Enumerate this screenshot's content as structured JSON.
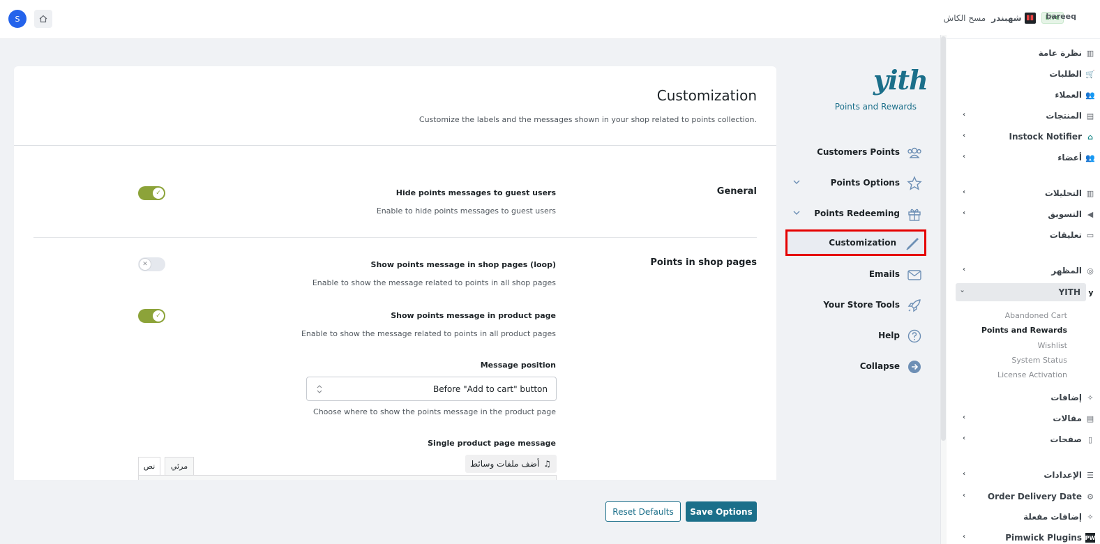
{
  "topbar": {
    "user_initial": "S",
    "site_name": "bareeq",
    "live_badge": "Live",
    "store_name": "شهبندر",
    "cash_link": "مسح الكاش"
  },
  "admin_menu": {
    "items": [
      {
        "label": "نظرة عامة",
        "icon": "chart-icon"
      },
      {
        "label": "الطلبات",
        "icon": "cart-icon"
      },
      {
        "label": "العملاء",
        "icon": "users-icon"
      },
      {
        "label": "المنتجات",
        "icon": "box-icon"
      },
      {
        "label": "Instock Notifier",
        "icon": "bank-icon"
      },
      {
        "label": "أعضاء",
        "icon": "users-icon"
      },
      {
        "label": "التحليلات",
        "icon": "chart-icon"
      },
      {
        "label": "التسويق",
        "icon": "megaphone-icon"
      },
      {
        "label": "تعليقات",
        "icon": "comment-icon"
      },
      {
        "label": "المظهر",
        "icon": "palette-icon"
      },
      {
        "label": "YITH",
        "icon": "yith-icon"
      },
      {
        "label": "إضافات",
        "icon": "plugin-icon"
      },
      {
        "label": "مقالات",
        "icon": "post-icon"
      },
      {
        "label": "صفحات",
        "icon": "page-icon"
      },
      {
        "label": "الإعدادات",
        "icon": "sliders-icon"
      },
      {
        "label": "Order Delivery Date",
        "icon": "gear-icon"
      },
      {
        "label": "إضافات مفعلة",
        "icon": "plugin-icon"
      },
      {
        "label": "Pimwick Plugins",
        "icon": "pw-icon"
      }
    ],
    "yith_submenu": [
      "Abandoned Cart",
      "Points and Rewards",
      "Wishlist",
      "System Status",
      "License Activation"
    ]
  },
  "plugin": {
    "logo_text": "yith",
    "title": "Points and Rewards",
    "nav": [
      {
        "label": "Customers Points",
        "icon": "users-icon"
      },
      {
        "label": "Points Options",
        "icon": "star-icon"
      },
      {
        "label": "Points Redeeming",
        "icon": "gift-icon"
      },
      {
        "label": "Customization",
        "icon": "brush-icon"
      },
      {
        "label": "Emails",
        "icon": "envelope-icon"
      },
      {
        "label": "Your Store Tools",
        "icon": "rocket-icon"
      },
      {
        "label": "Help",
        "icon": "help-icon"
      },
      {
        "label": "Collapse",
        "icon": "arrow-right-icon"
      }
    ]
  },
  "page": {
    "title": "Customization",
    "description": "Customize the labels and the messages shown in your shop related to points collection.",
    "sections": {
      "general": "General",
      "shop_pages": "Points in shop pages"
    },
    "options": {
      "hide_guest_label": "Hide points messages to guest users",
      "hide_guest_desc": "Enable to hide points messages to guest users",
      "hide_guest_on": true,
      "loop_label": "Show points message in shop pages (loop)",
      "loop_desc": "Enable to show the message related to points in all shop pages",
      "loop_on": false,
      "product_label": "Show points message in product page",
      "product_desc": "Enable to show the message related to points in all product pages",
      "product_on": true,
      "position_label": "Message position",
      "position_value": "Before \"Add to cart\" button",
      "position_desc": "Choose where to show the points message in the product page",
      "single_msg_label": "Single product page message",
      "media_button": "أضف ملفات وسائط",
      "tab_visual": "مرئي",
      "tab_text": "نص"
    },
    "buttons": {
      "reset": "Reset Defaults",
      "save": "Save Options"
    }
  },
  "colors": {
    "accent": "#1b6f8a",
    "toggle_on": "#8ca339",
    "highlight": "#e50000"
  }
}
